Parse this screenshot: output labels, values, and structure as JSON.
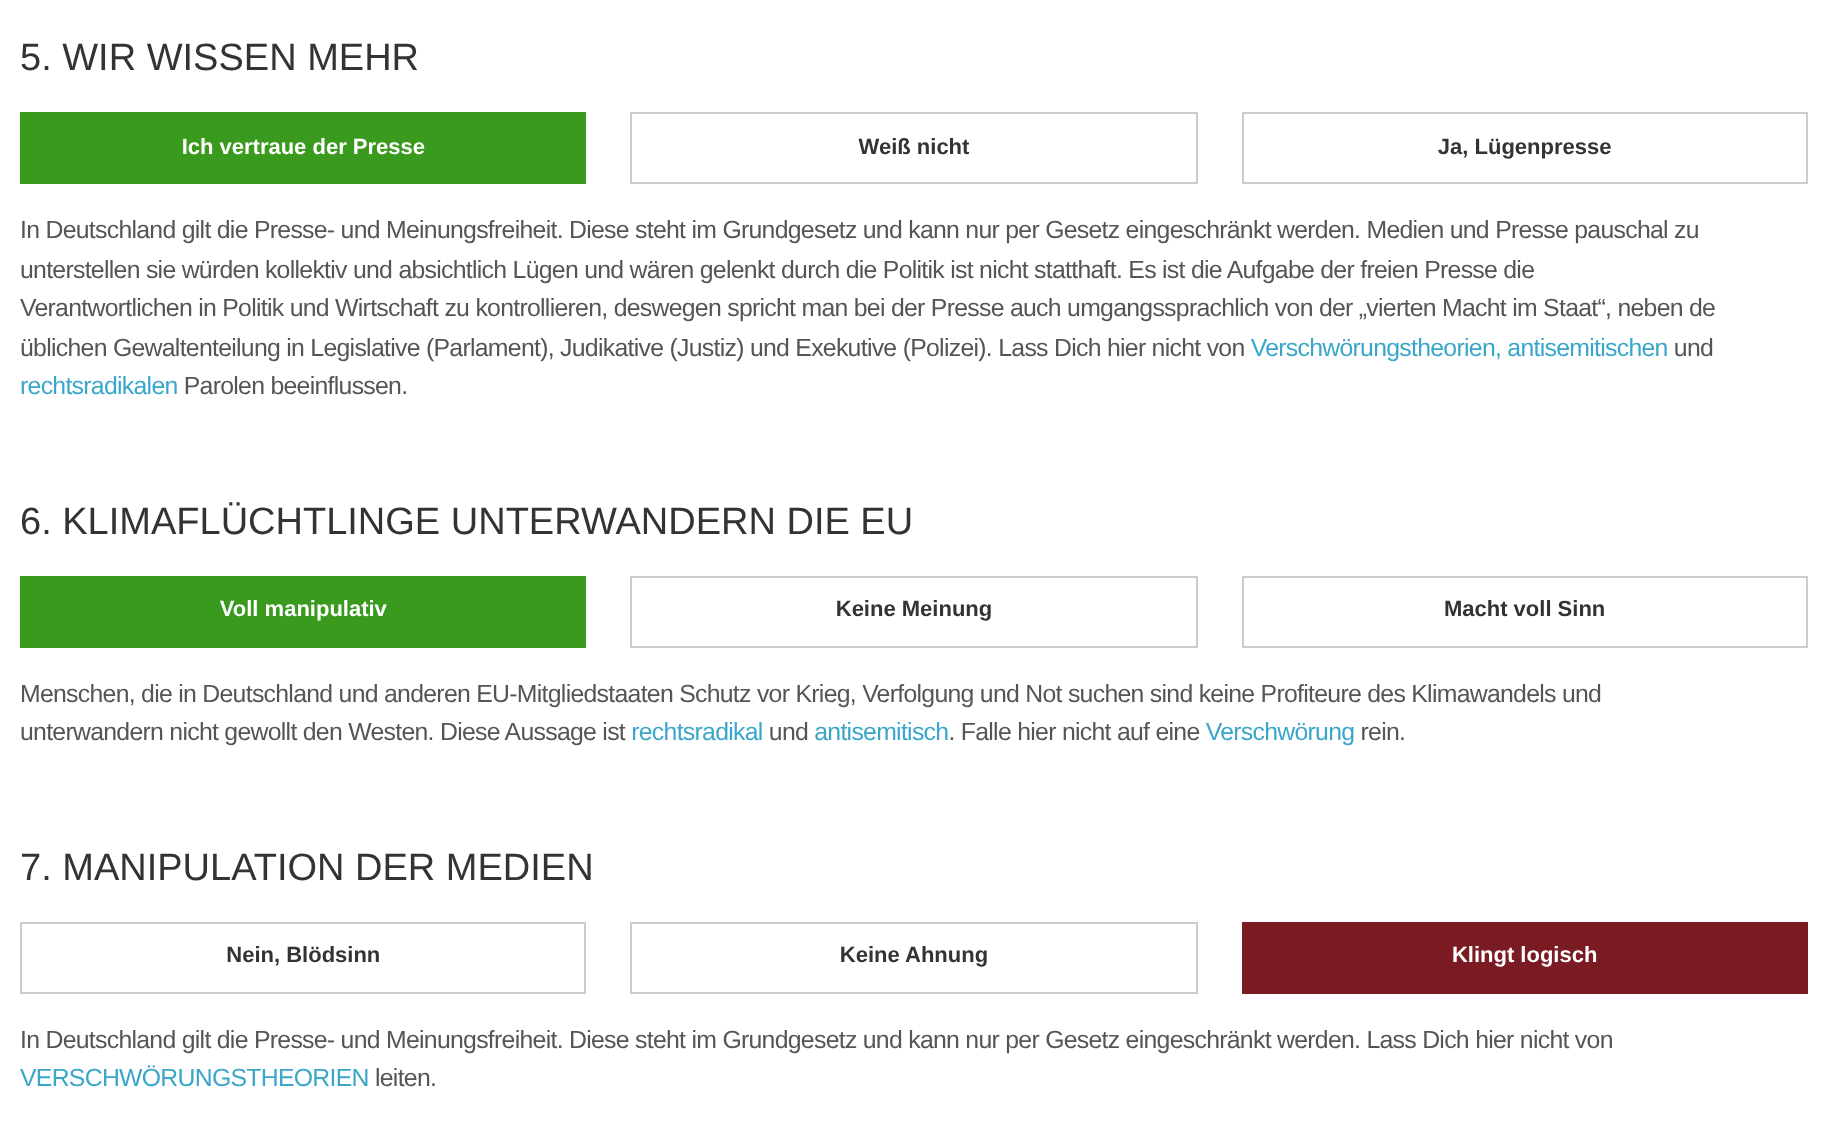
{
  "questions": [
    {
      "title": "5. WIR WISSEN MEHR",
      "kind": "correct",
      "options": [
        {
          "label": "Ich vertraue der Presse",
          "selected": true
        },
        {
          "label": "Weiß nicht",
          "selected": false
        },
        {
          "label": "Ja, Lügenpresse",
          "selected": false
        }
      ],
      "explanation": [
        [
          {
            "text": "In Deutschland gilt die Presse- und Meinungsfreiheit. Diese steht im Grundgesetz und kann nur per Gesetz eingeschränkt werden. Medien und Presse pauschal zu",
            "link": false
          }
        ],
        [
          {
            "text": "unterstellen sie würden kollektiv und absichtlich Lügen und wären gelenkt durch die Politik ist nicht statthaft. Es ist die Aufgabe der freien Presse die",
            "link": false
          }
        ],
        [
          {
            "text": "Verantwortlichen in Politik und Wirtschaft zu kontrollieren, deswegen spricht man bei der Presse auch umgangssprachlich von der „vierten Macht im Staat“, neben de",
            "link": false
          }
        ],
        [
          {
            "text": "üblichen Gewaltenteilung in Legislative (Parlament), Judikative (Justiz) und Exekutive (Polizei). Lass Dich hier nicht von ",
            "link": false
          },
          {
            "text": "Verschwörungstheorien, antisemitischen",
            "link": true
          },
          {
            "text": " und",
            "link": false
          }
        ],
        [
          {
            "text": "rechtsradikalen",
            "link": true
          },
          {
            "text": " Parolen beeinflussen.",
            "link": false
          }
        ]
      ]
    },
    {
      "title": "6. KLIMAFLÜCHTLINGE UNTERWANDERN DIE EU",
      "kind": "correct",
      "options": [
        {
          "label": "Voll manipulativ",
          "selected": true
        },
        {
          "label": "Keine Meinung",
          "selected": false
        },
        {
          "label": "Macht voll Sinn",
          "selected": false
        }
      ],
      "explanation": [
        [
          {
            "text": "Menschen, die in Deutschland und anderen EU-Mitgliedstaaten Schutz vor Krieg, Verfolgung und Not suchen sind keine Profiteure des Klimawandels und",
            "link": false
          }
        ],
        [
          {
            "text": "unterwandern nicht gewollt den Westen. Diese Aussage ist ",
            "link": false
          },
          {
            "text": "rechtsradikal",
            "link": true
          },
          {
            "text": " und ",
            "link": false
          },
          {
            "text": "antisemitisch",
            "link": true
          },
          {
            "text": ". Falle hier nicht auf eine ",
            "link": false
          },
          {
            "text": "Verschwörung",
            "link": true
          },
          {
            "text": " rein.",
            "link": false
          }
        ]
      ]
    },
    {
      "title": "7. MANIPULATION DER MEDIEN",
      "kind": "wrong",
      "options": [
        {
          "label": "Nein, Blödsinn",
          "selected": false
        },
        {
          "label": "Keine Ahnung",
          "selected": false
        },
        {
          "label": "Klingt logisch",
          "selected": true
        }
      ],
      "explanation": [
        [
          {
            "text": "In Deutschland gilt die Presse- und Meinungsfreiheit. Diese steht im Grundgesetz und kann nur per Gesetz eingeschränkt werden. Lass Dich hier nicht von",
            "link": false
          }
        ],
        [
          {
            "text": "VERSCHWÖRUNGSTHEORIEN",
            "link": true
          },
          {
            "text": " leiten.",
            "link": false
          }
        ]
      ]
    }
  ]
}
